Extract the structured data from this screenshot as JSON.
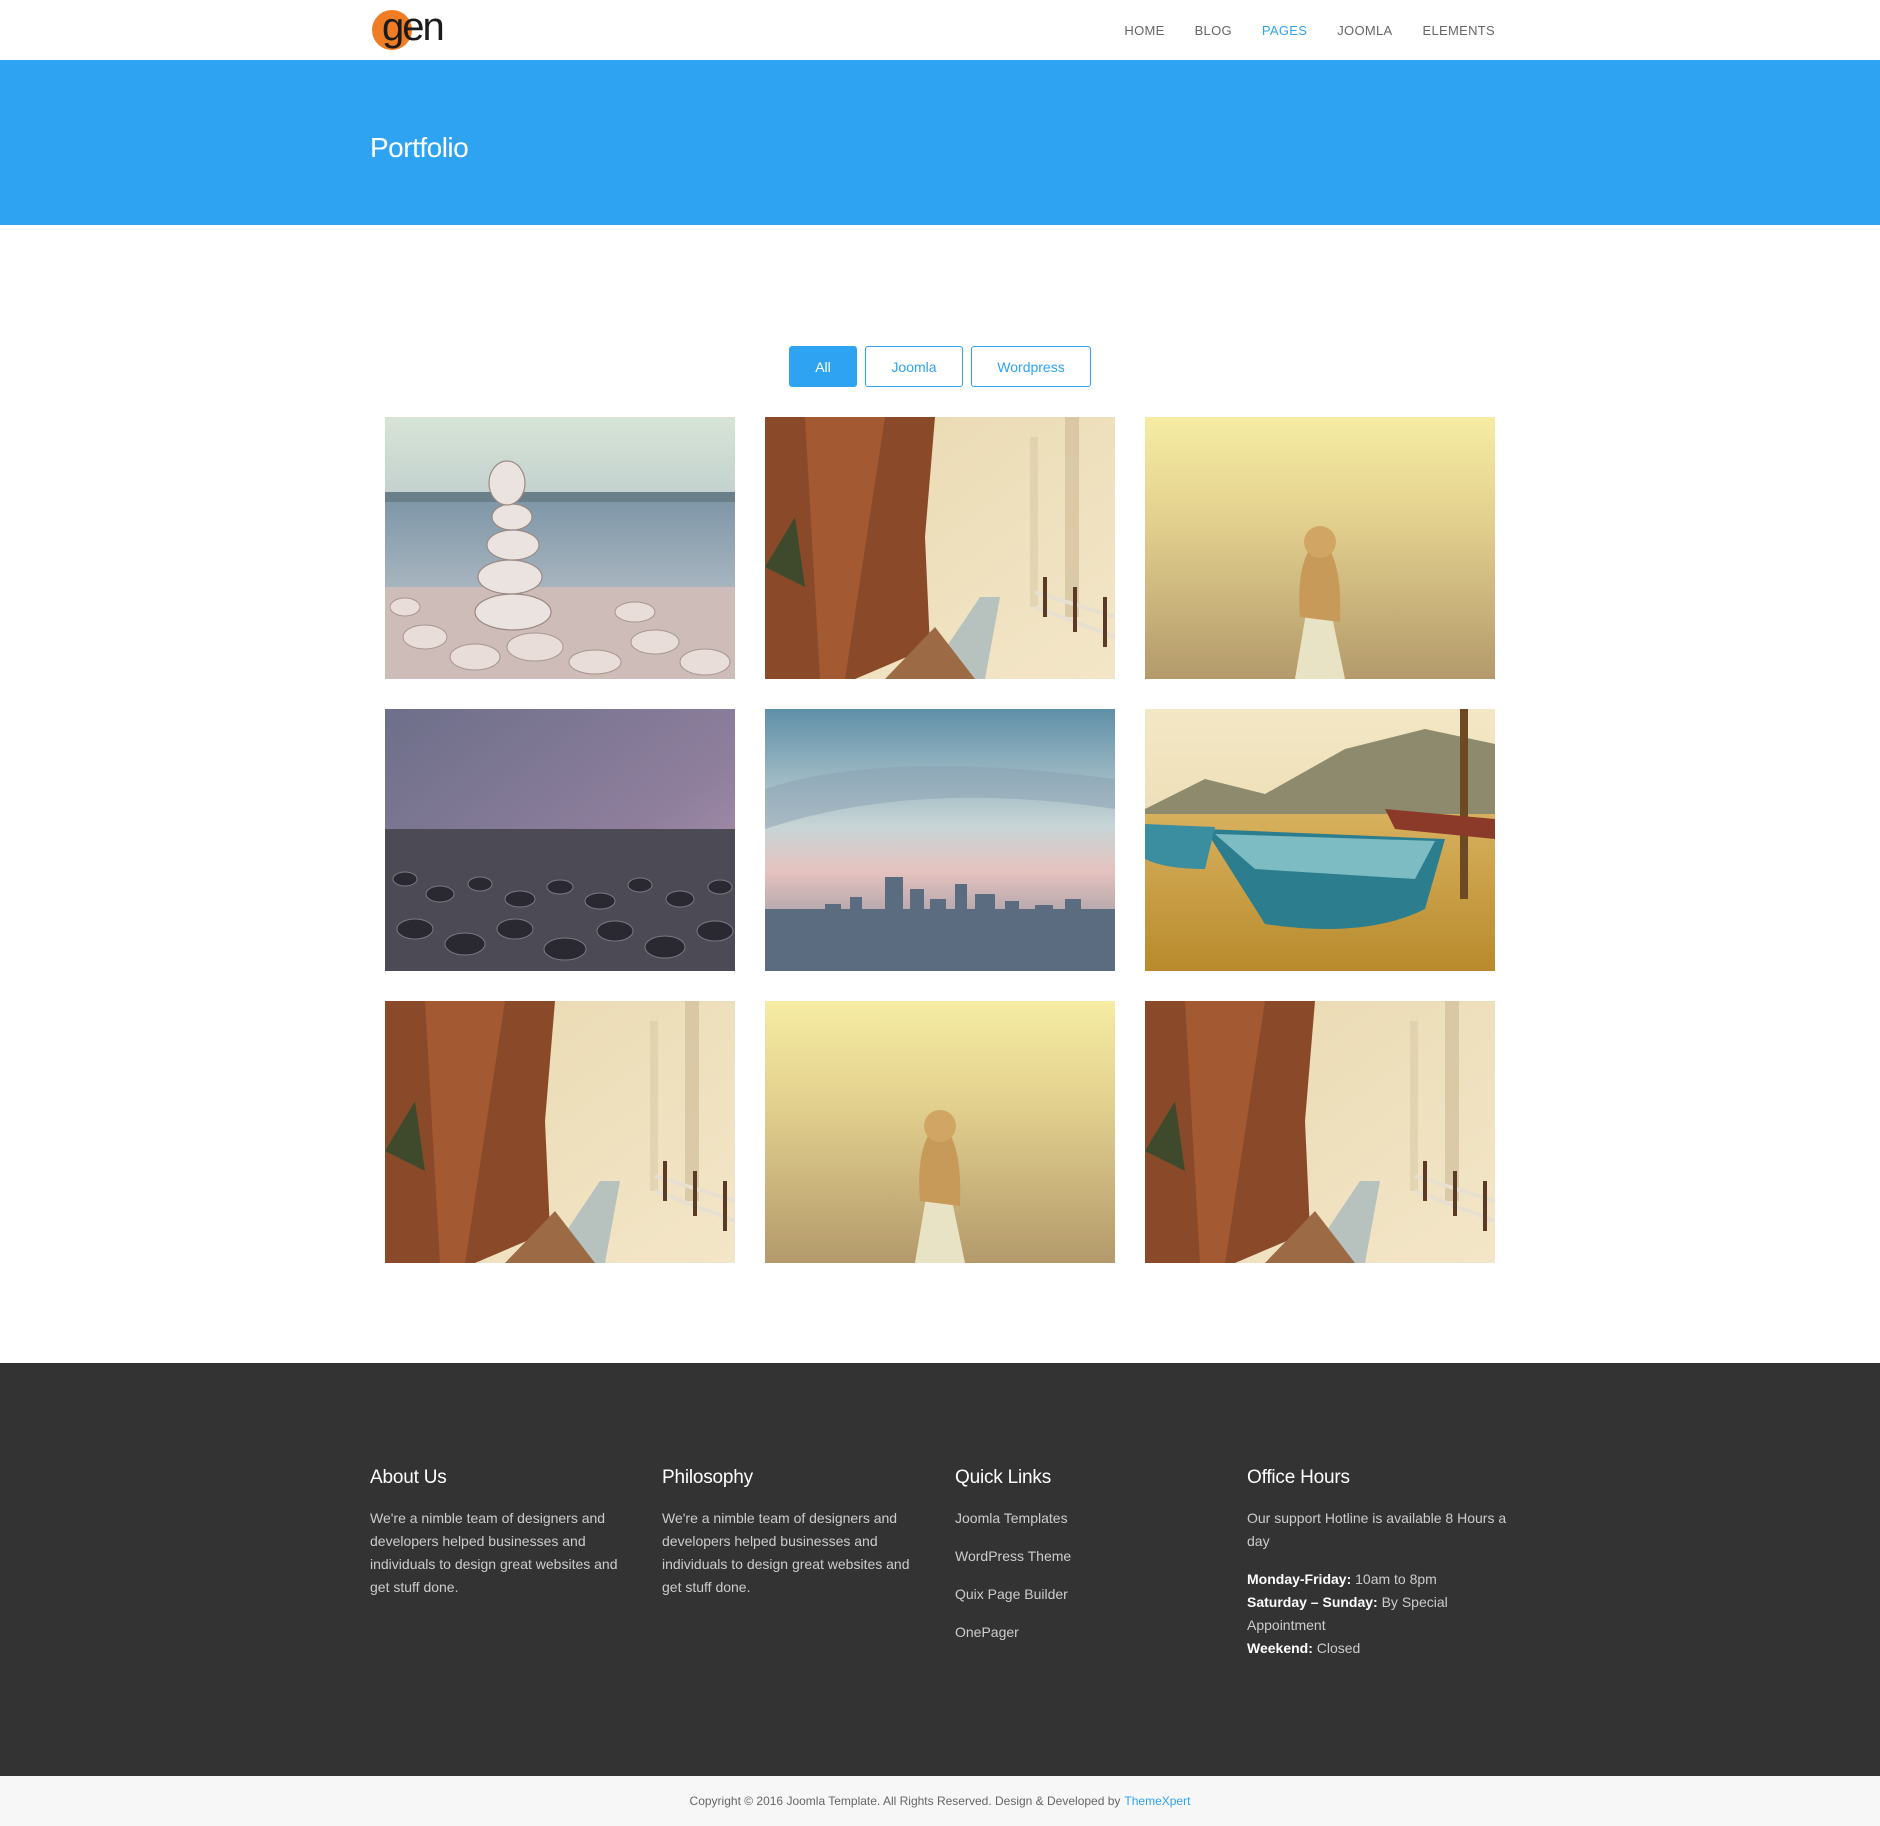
{
  "brand": {
    "logo_text": "gen",
    "accent_color": "#2ea3f2",
    "logo_color": "#f07d24"
  },
  "nav": {
    "items": [
      {
        "label": "HOME",
        "active": false
      },
      {
        "label": "BLOG",
        "active": false
      },
      {
        "label": "PAGES",
        "active": true
      },
      {
        "label": "JOOMLA",
        "active": false
      },
      {
        "label": "ELEMENTS",
        "active": false
      }
    ]
  },
  "banner": {
    "title": "Portfolio"
  },
  "filters": {
    "all": "All",
    "joomla": "Joomla",
    "wordpress": "Wordpress",
    "selected": "All"
  },
  "portfolio": {
    "items": [
      {
        "image": "stacked-stones-image"
      },
      {
        "image": "forest-tree-path-image"
      },
      {
        "image": "girl-in-field-image"
      },
      {
        "image": "pebble-beach-image"
      },
      {
        "image": "city-skyline-image"
      },
      {
        "image": "boats-on-lake-image"
      },
      {
        "image": "forest-tree-path-image"
      },
      {
        "image": "girl-in-field-image"
      },
      {
        "image": "forest-tree-path-image"
      }
    ]
  },
  "footer": {
    "about": {
      "title": "About Us",
      "text": "We're a nimble team of designers and developers helped businesses and individuals to design great websites and get stuff done."
    },
    "philosophy": {
      "title": "Philosophy",
      "text": "We're a nimble team of designers and developers helped businesses and individuals to design great websites and get stuff done."
    },
    "quick_links": {
      "title": "Quick Links",
      "links": [
        "Joomla Templates",
        "WordPress Theme",
        "Quix Page Builder",
        "OnePager"
      ]
    },
    "office_hours": {
      "title": "Office Hours",
      "intro": "Our support Hotline is available 8 Hours a day",
      "weekdays_label": "Monday-Friday:",
      "weekdays_value": "10am to 8pm",
      "weekend_days_label": "Saturday – Sunday:",
      "weekend_days_value": "By Special Appointment",
      "weekend_label": "Weekend:",
      "weekend_value": "Closed"
    }
  },
  "copyright": {
    "text": "Copyright © 2016 Joomla Template. All Rights Reserved. Design & Developed by",
    "link_text": "ThemeXpert"
  }
}
